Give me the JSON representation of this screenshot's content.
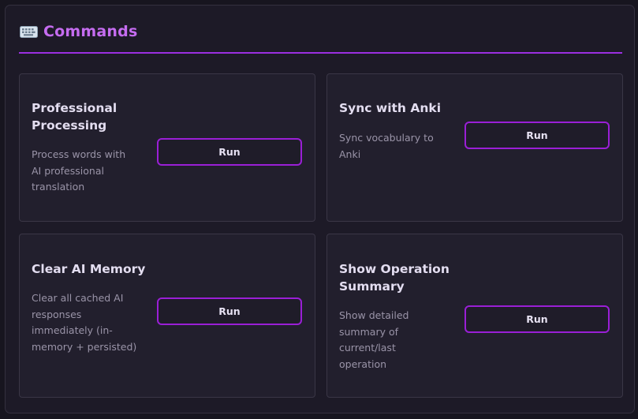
{
  "panel": {
    "title": "Commands",
    "icon": "keyboard-icon"
  },
  "colors": {
    "accent": "#c56cf0",
    "button_border": "#9a1fd6",
    "rule": "#9b2fe0",
    "panel_bg": "#1d1a27",
    "card_bg": "#221f2d"
  },
  "commands": [
    {
      "title": "Professional Processing",
      "description": "Process words with AI professional translation",
      "button_label": "Run"
    },
    {
      "title": "Sync with Anki",
      "description": "Sync vocabulary to Anki",
      "button_label": "Run"
    },
    {
      "title": "Clear AI Memory",
      "description": "Clear all cached AI responses immediately (in-memory + persisted)",
      "button_label": "Run"
    },
    {
      "title": "Show Operation Summary",
      "description": "Show detailed summary of current/last operation",
      "button_label": "Run"
    }
  ]
}
